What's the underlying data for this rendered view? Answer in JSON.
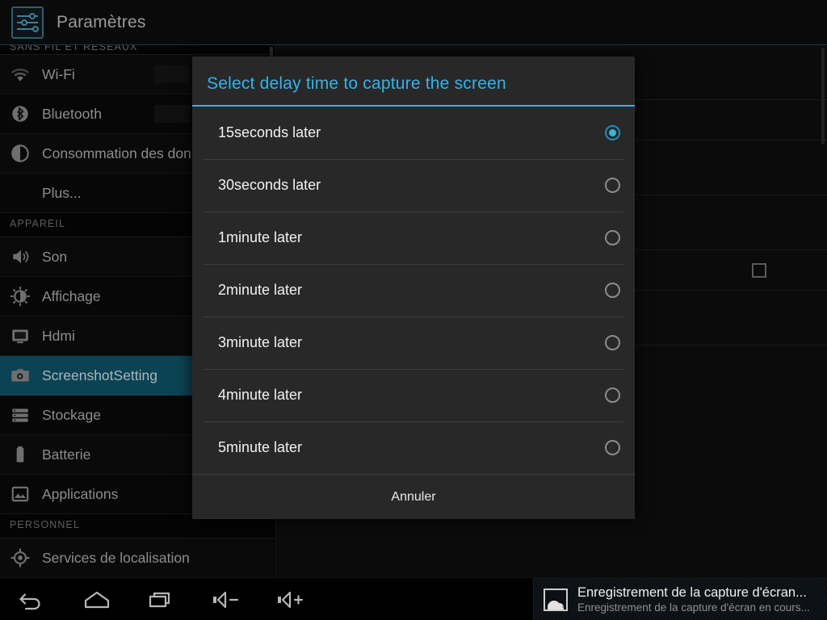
{
  "app": {
    "title": "Paramètres",
    "icon": "settings-sliders-icon"
  },
  "sidebar": {
    "sections": [
      {
        "header": "SANS FIL ET RÉSEAUX",
        "truncated": true,
        "items": [
          {
            "label": "Wi-Fi",
            "icon": "wifi-icon",
            "selected": false,
            "has_toggle": true
          },
          {
            "label": "Bluetooth",
            "icon": "bluetooth-icon",
            "selected": false,
            "has_toggle": true
          },
          {
            "label": "Consommation des données",
            "icon": "data-usage-icon",
            "selected": false,
            "has_toggle": false
          },
          {
            "label": "Plus...",
            "icon": "none",
            "selected": false,
            "has_toggle": false
          }
        ]
      },
      {
        "header": "APPAREIL",
        "truncated": false,
        "items": [
          {
            "label": "Son",
            "icon": "sound-icon",
            "selected": false,
            "has_toggle": false
          },
          {
            "label": "Affichage",
            "icon": "display-brightness-icon",
            "selected": false,
            "has_toggle": false
          },
          {
            "label": "Hdmi",
            "icon": "hdmi-monitor-icon",
            "selected": false,
            "has_toggle": false
          },
          {
            "label": "ScreenshotSetting",
            "icon": "camera-icon",
            "selected": true,
            "has_toggle": false
          },
          {
            "label": "Stockage",
            "icon": "storage-icon",
            "selected": false,
            "has_toggle": false
          },
          {
            "label": "Batterie",
            "icon": "battery-icon",
            "selected": false,
            "has_toggle": false
          },
          {
            "label": "Applications",
            "icon": "applications-icon",
            "selected": false,
            "has_toggle": false
          }
        ]
      },
      {
        "header": "PERSONNEL",
        "truncated": false,
        "items": [
          {
            "label": "Services de localisation",
            "icon": "location-icon",
            "selected": false,
            "has_toggle": false
          }
        ]
      }
    ]
  },
  "dialog": {
    "title": "Select delay time to capture the screen",
    "title_color": "#34b3ea",
    "selected_value": "15seconds later",
    "options": [
      {
        "label": "15seconds later",
        "selected": true
      },
      {
        "label": "30seconds later",
        "selected": false
      },
      {
        "label": "1minute later",
        "selected": false
      },
      {
        "label": "2minute later",
        "selected": false
      },
      {
        "label": "3minute later",
        "selected": false
      },
      {
        "label": "4minute later",
        "selected": false
      },
      {
        "label": "5minute later",
        "selected": false
      }
    ],
    "cancel_label": "Annuler"
  },
  "notification": {
    "icon": "image-picture-icon",
    "title": "Enregistrement de la capture d'écran...",
    "subtitle": "Enregistrement de la capture d'écran en cours..."
  },
  "navbar": {
    "keys": [
      {
        "name": "back-button",
        "icon": "back-arrow-icon"
      },
      {
        "name": "home-button",
        "icon": "home-icon"
      },
      {
        "name": "recents-button",
        "icon": "recents-icon"
      },
      {
        "name": "volume-down-button",
        "icon": "volume-down-icon"
      },
      {
        "name": "volume-up-button",
        "icon": "volume-up-icon"
      }
    ]
  },
  "colors": {
    "accent": "#33b5e5",
    "selected_row": "#0c4354",
    "dialog_bg": "#282828",
    "screen_bg": "#050505"
  }
}
